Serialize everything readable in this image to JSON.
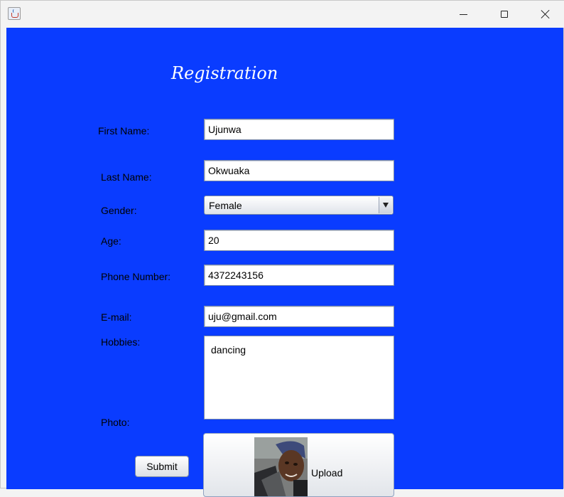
{
  "window": {
    "title": ""
  },
  "form": {
    "heading": "Registration",
    "first_name_label": "First Name:",
    "first_name_value": "Ujunwa",
    "last_name_label": "Last Name:",
    "last_name_value": "Okwuaka",
    "gender_label": "Gender:",
    "gender_value": "Female",
    "age_label": "Age:",
    "age_value": "20",
    "phone_label": "Phone Number:",
    "phone_value": "4372243156",
    "email_label": "E-mail:",
    "email_value": "uju@gmail.com",
    "hobbies_label": "Hobbies:",
    "hobbies_value": "dancing",
    "photo_label": "Photo:",
    "submit_label": "Submit",
    "upload_label": "Upload"
  },
  "colors": {
    "background": "#0a3cff",
    "heading": "#ffffff"
  },
  "icons": {
    "app": "java-cup-icon",
    "minimize": "minimize-icon",
    "maximize": "maximize-icon",
    "close": "close-icon"
  }
}
